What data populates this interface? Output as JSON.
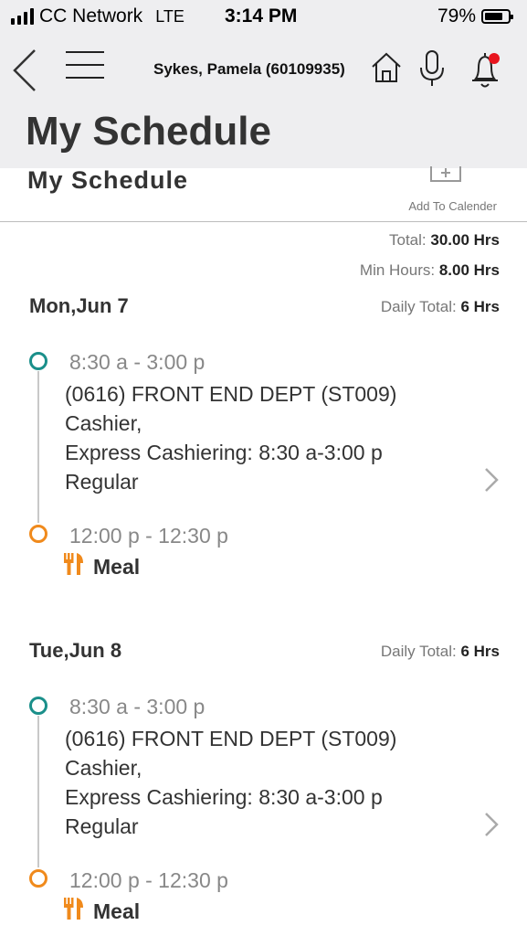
{
  "status_bar": {
    "carrier": "CC Network",
    "network": "LTE",
    "time": "3:14 PM",
    "battery": "79%",
    "battery_level": 0.79
  },
  "header": {
    "user": "Sykes, Pamela (60109935)"
  },
  "page_title": "My Schedule",
  "sub_header": {
    "title": "My Schedule",
    "add_to_calendar": "Add To Calender"
  },
  "summary": {
    "total_label": "Total:",
    "total_value": "30.00 Hrs",
    "min_label": "Min Hours:",
    "min_value": "8.00 Hrs"
  },
  "days": [
    {
      "date": "Mon,Jun 7",
      "daily_total_label": "Daily Total:",
      "daily_total_value": "6 Hrs",
      "shift": {
        "time": "8:30 a - 3:00 p",
        "department": "(0616) FRONT END DEPT   (ST009)",
        "job": "Cashier,",
        "activity": "Express Cashiering: 8:30 a-3:00 p",
        "type": "Regular"
      },
      "meal": {
        "time": "12:00 p - 12:30 p",
        "label": "Meal"
      }
    },
    {
      "date": "Tue,Jun 8",
      "daily_total_label": "Daily Total:",
      "daily_total_value": "6 Hrs",
      "shift": {
        "time": "8:30 a - 3:00 p",
        "department": "(0616) FRONT END DEPT   (ST009)",
        "job": "Cashier,",
        "activity": "Express Cashiering: 8:30 a-3:00 p",
        "type": "Regular"
      },
      "meal": {
        "time": "12:00 p - 12:30 p",
        "label": "Meal"
      }
    }
  ],
  "colors": {
    "accent_teal": "#1a8f8a",
    "accent_orange": "#f08a1c",
    "notification": "#e8141e",
    "header_bg": "#eeeef0"
  },
  "icons": [
    "back-icon",
    "menu-icon",
    "home-icon",
    "microphone-icon",
    "bell-icon",
    "calendar-add-icon",
    "chevron-right-icon",
    "fork-knife-icon"
  ]
}
